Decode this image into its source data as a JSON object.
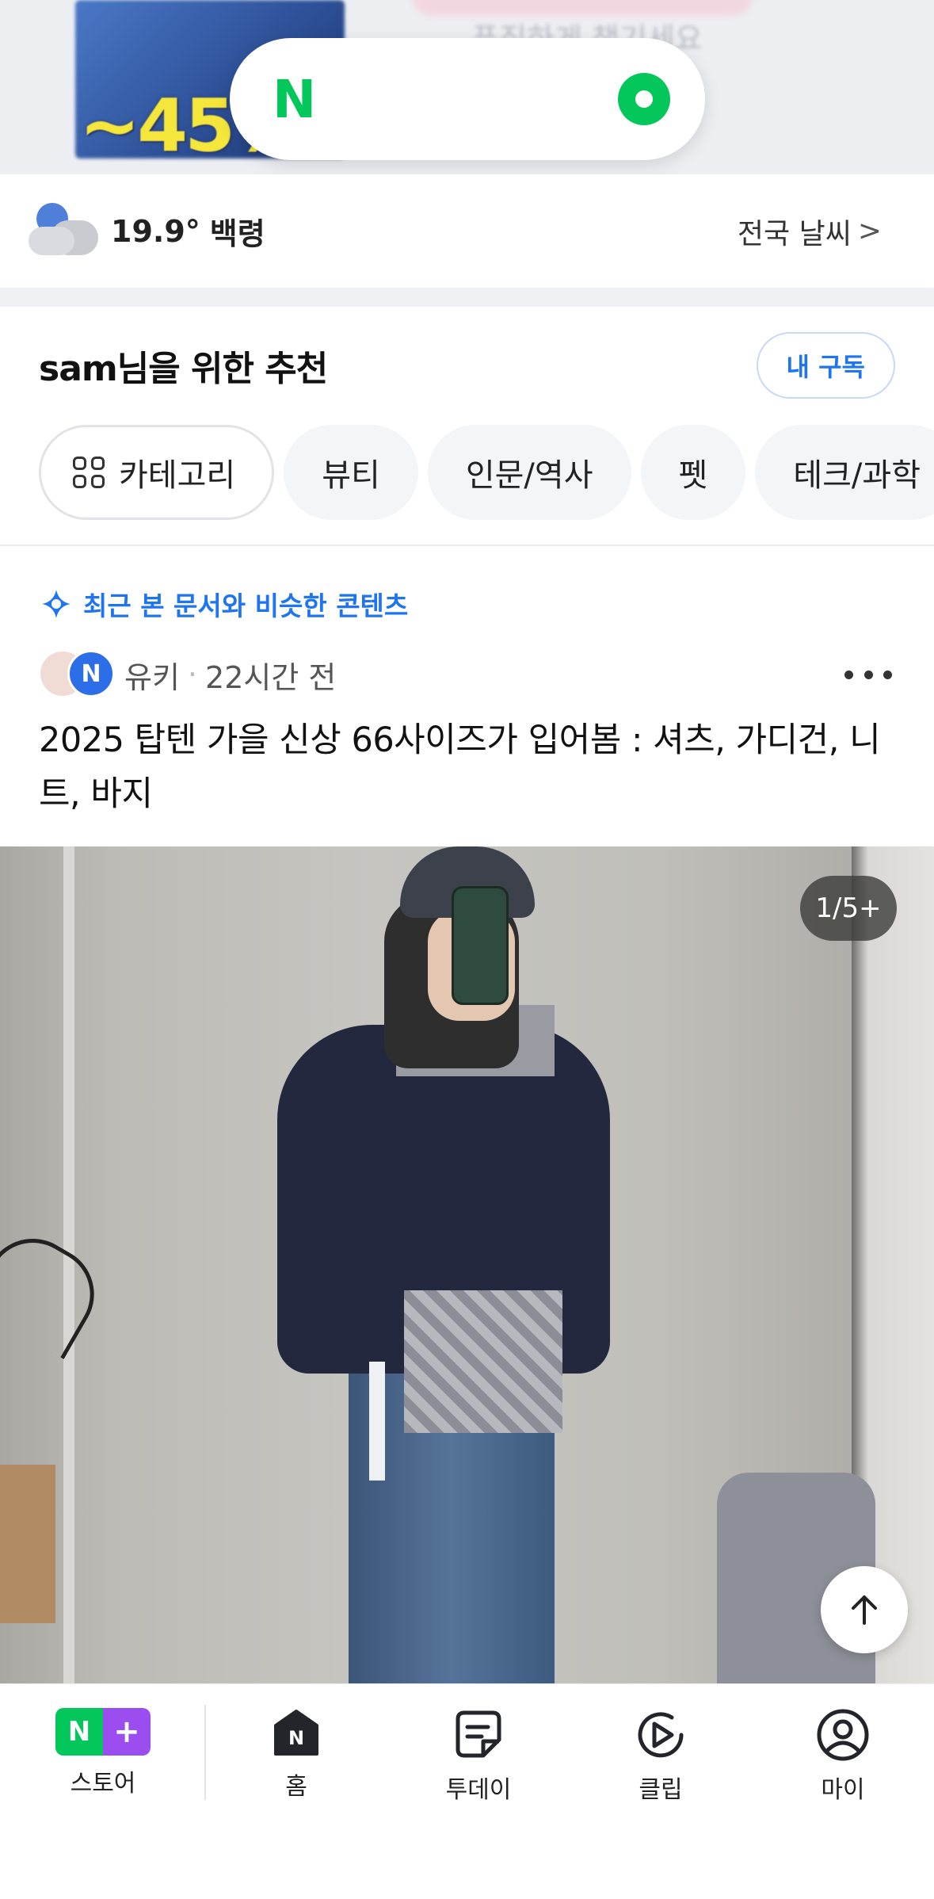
{
  "banner": {
    "discount": "~45%",
    "text": "푸짐하게 챙기세요"
  },
  "search": {
    "logo": "N",
    "icons": [
      "naver-logo-icon",
      "green-dot-icon"
    ]
  },
  "weather": {
    "temperature": "19.9°",
    "location": "백령",
    "link": "전국 날씨",
    "link_chevron": ">",
    "icon": "moon-cloud-icon"
  },
  "recommend": {
    "title": "sam님을 위한 추천",
    "subscribe_label": "내 구독",
    "chips": [
      "카테고리",
      "뷰티",
      "인문/역사",
      "펫",
      "테크/과학"
    ]
  },
  "card": {
    "similar_label": "최근 본 문서와 비슷한 콘텐츠",
    "author": "유키",
    "time": "22시간 전",
    "badge": "N",
    "title": "2025 탑텐 가을 신상 66사이즈가 입어봄 : 셔츠, 가디건, 니트, 바지",
    "page_counter": "1/5+"
  },
  "nav": {
    "store_n": "N",
    "store_plus": "+",
    "items": [
      "스토어",
      "홈",
      "투데이",
      "클립",
      "마이"
    ]
  },
  "colors": {
    "naver_green": "#03c75a",
    "link_blue": "#1f74f0",
    "store_purple": "#9b4df0"
  }
}
